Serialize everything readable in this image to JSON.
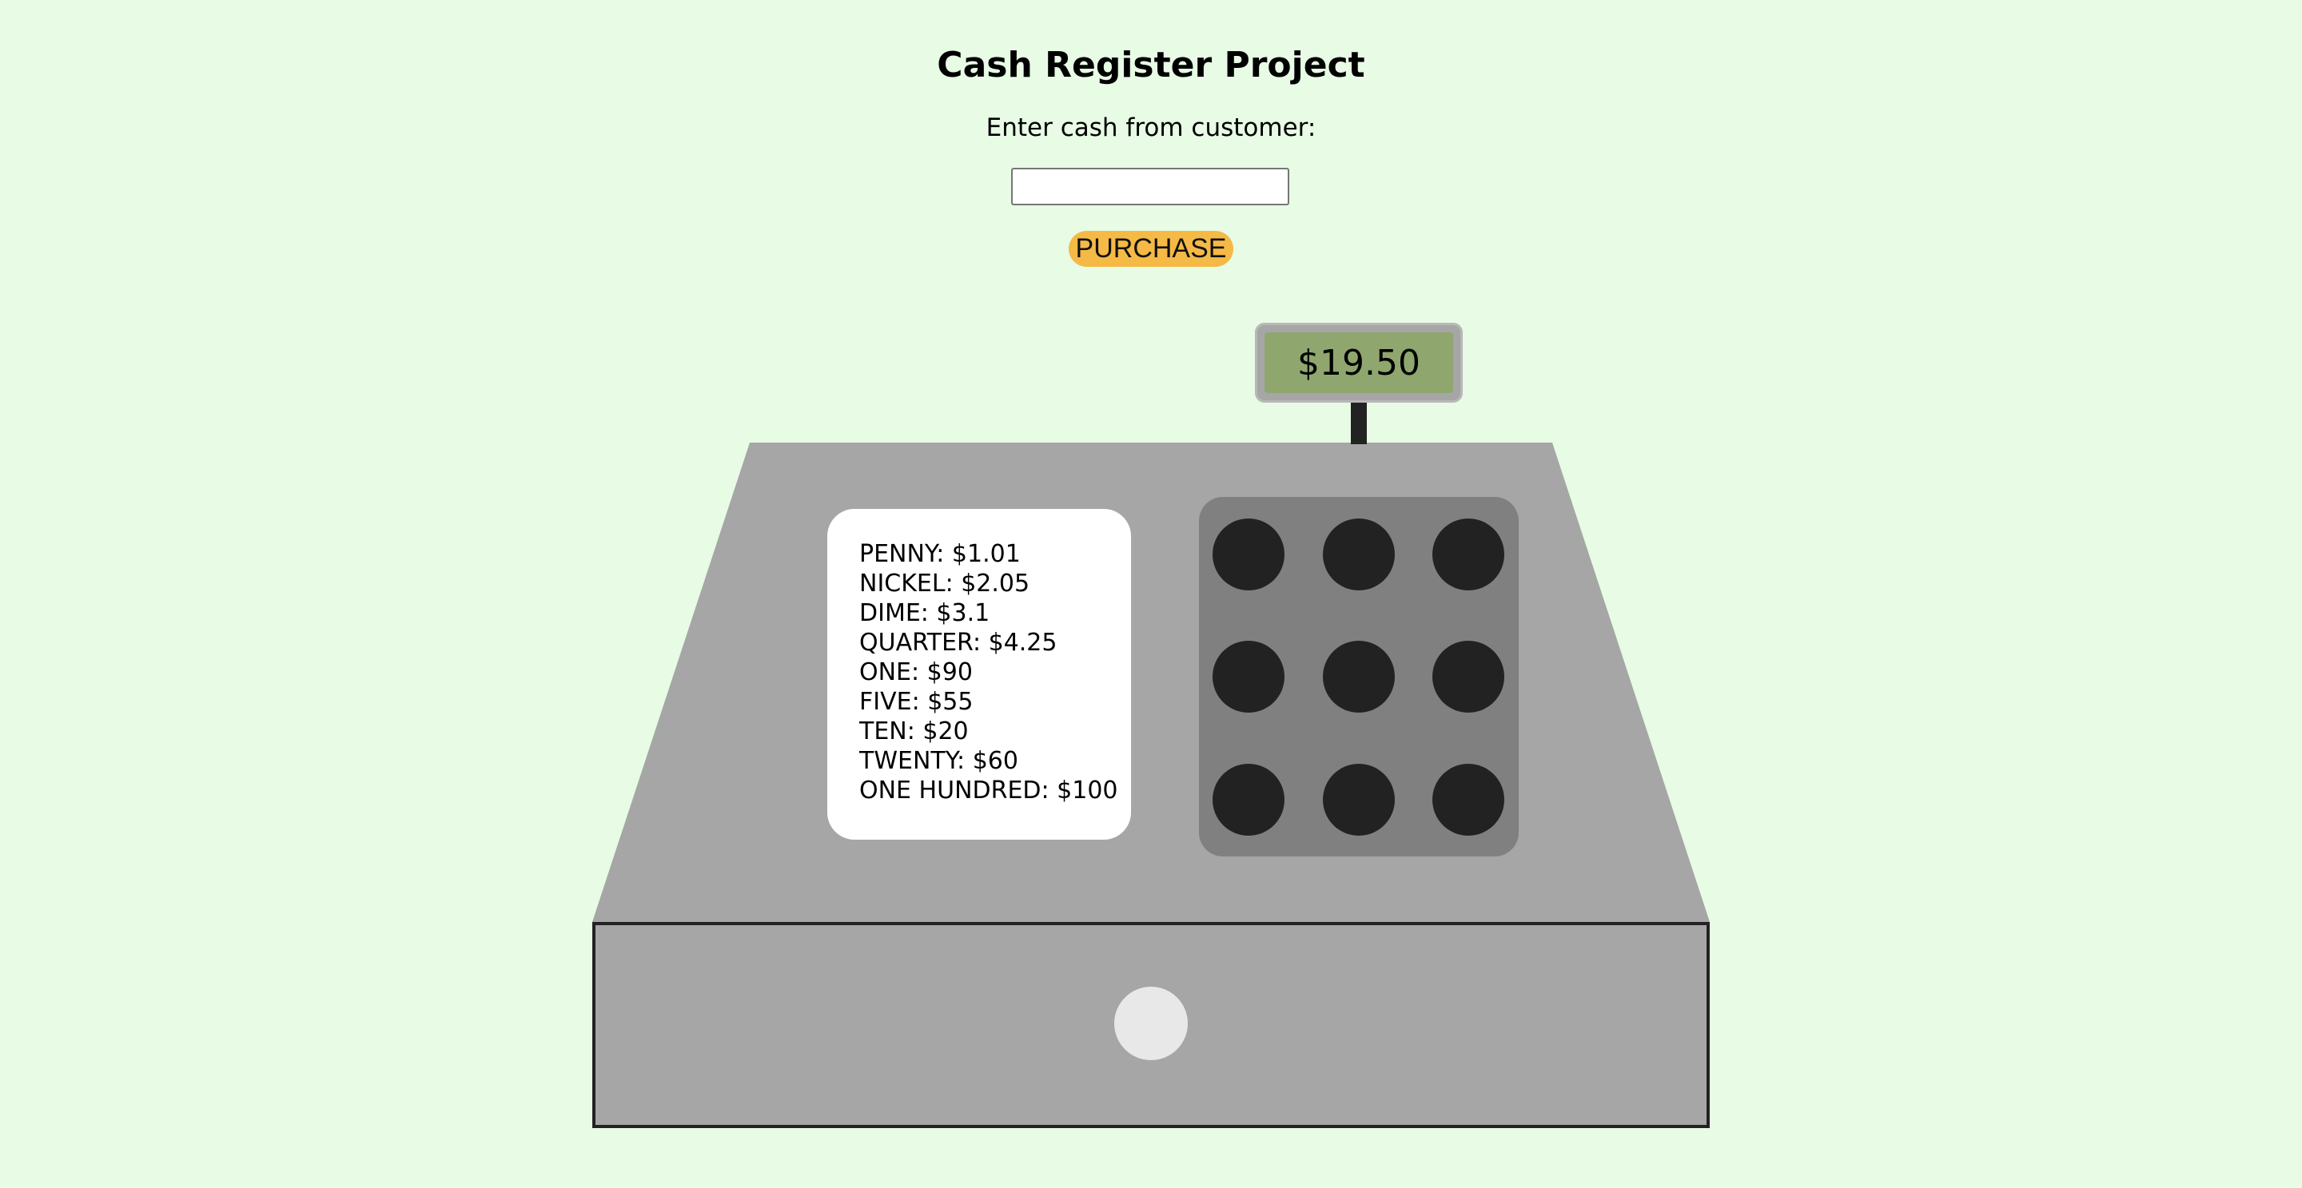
{
  "page": {
    "title": "Cash Register Project",
    "cash_label": "Enter cash from customer:",
    "cash_input_value": "",
    "cash_input_placeholder": ""
  },
  "actions": {
    "purchase_label": "PURCHASE"
  },
  "register": {
    "display_price": "$19.50",
    "cash_in_drawer": [
      "PENNY: $1.01",
      "NICKEL: $2.05",
      "DIME: $3.1",
      "QUARTER: $4.25",
      "ONE: $90",
      "FIVE: $55",
      "TEN: $20",
      "TWENTY: $60",
      "ONE HUNDRED: $100"
    ]
  },
  "colors": {
    "background": "#e7fbe5",
    "register_body": "#a6a6a6",
    "keypad": "#808080",
    "keys": "#222222",
    "display_screen": "#8fa76f",
    "purchase_button": "#f5b945",
    "drawer_knob": "#e8e8e8"
  }
}
